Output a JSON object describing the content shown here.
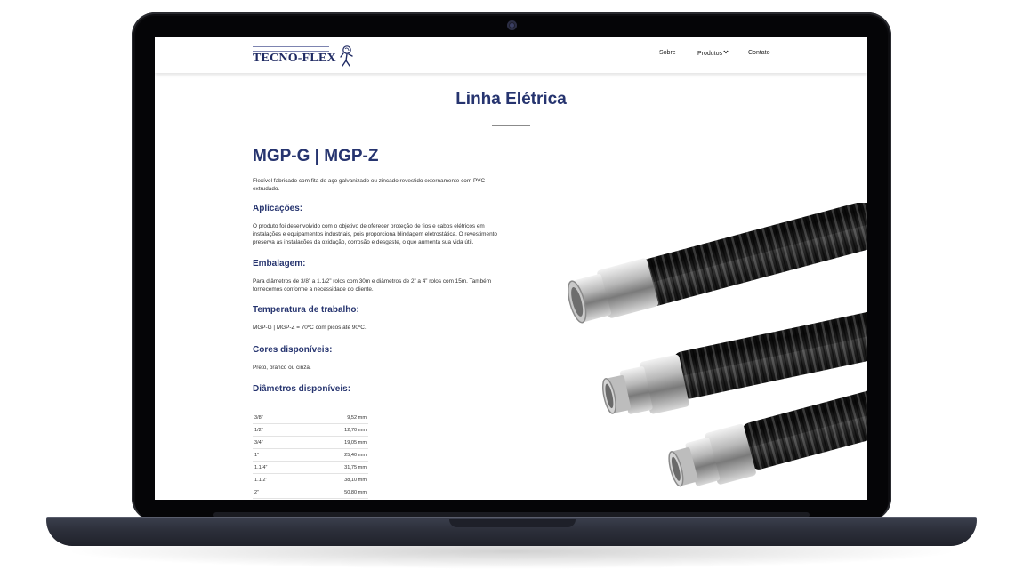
{
  "nav": {
    "logo_text": "TECNO-FLEX",
    "items": [
      {
        "label": "Sobre"
      },
      {
        "label": "Produtos"
      },
      {
        "label": "Contato"
      }
    ],
    "dropdown_icon": "chevron-down-icon"
  },
  "page": {
    "title": "Linha Elétrica"
  },
  "product": {
    "title": "MGP-G | MGP-Z",
    "description": "Flexível fabricado com fita de aço galvanizado ou zincado revestido externamente com PVC extrudado.",
    "sections": [
      {
        "heading": "Aplicações:",
        "text": "O produto foi desenvolvido com o objetivo de oferecer proteção de fios e cabos elétricos em instalações e equipamentos industriais, pois proporciona blindagem eletrostática. O revestimento preserva as instalações da oxidação, corrosão e desgaste, o que aumenta sua vida útil."
      },
      {
        "heading": "Embalagem:",
        "text": "Para diâmetros de 3/8” a 1.1/2” rolos com 30m e diâmetros de 2” a 4” rolos com 15m. Também fornecemos conforme a necessidade do cliente."
      },
      {
        "heading": "Temperatura de trabalho:",
        "text": "MGP-G | MGP-Z = 70ºC com picos até 90ºC."
      },
      {
        "heading": "Cores disponíveis:",
        "text": "Preto, branco ou cinza."
      },
      {
        "heading": "Diâmetros disponíveis:",
        "text": ""
      }
    ],
    "diameters": [
      {
        "size": "3/8”",
        "mm": "9,52 mm"
      },
      {
        "size": "1/2”",
        "mm": "12,70 mm"
      },
      {
        "size": "3/4”",
        "mm": "19,05 mm"
      },
      {
        "size": "1”",
        "mm": "25,40 mm"
      },
      {
        "size": "1.1/4”",
        "mm": "31,75 mm"
      },
      {
        "size": "1.1/2”",
        "mm": "38,10 mm"
      },
      {
        "size": "2”",
        "mm": "50,80 mm"
      }
    ]
  },
  "colors": {
    "brand_blue": "#26346f",
    "laptop_body": "#2c2f3a"
  }
}
